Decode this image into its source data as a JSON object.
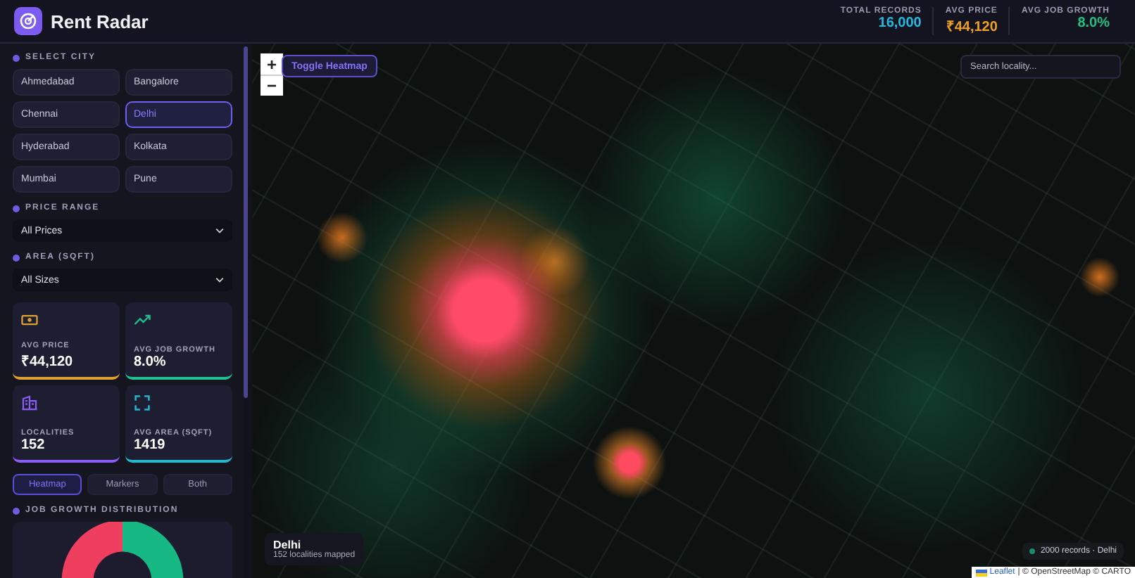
{
  "header": {
    "title": "Rent Radar",
    "stats": [
      {
        "label": "TOTAL RECORDS",
        "value": "16,000",
        "color": "#22b8e0"
      },
      {
        "label": "AVG PRICE",
        "value": "₹44,120",
        "color": "#f0a020"
      },
      {
        "label": "AVG JOB GROWTH",
        "value": "8.0%",
        "color": "#20c080"
      }
    ]
  },
  "sidebar": {
    "city_heading": "SELECT CITY",
    "cities": [
      {
        "label": "Ahmedabad",
        "selected": false
      },
      {
        "label": "Bangalore",
        "selected": false
      },
      {
        "label": "Chennai",
        "selected": false
      },
      {
        "label": "Delhi",
        "selected": true
      },
      {
        "label": "Hyderabad",
        "selected": false
      },
      {
        "label": "Kolkata",
        "selected": false
      },
      {
        "label": "Mumbai",
        "selected": false
      },
      {
        "label": "Pune",
        "selected": false
      }
    ],
    "price_heading": "PRICE RANGE",
    "price_value": "All Prices",
    "area_heading": "AREA (SQFT)",
    "area_value": "All Sizes",
    "cards": [
      {
        "kind": "price",
        "label": "AVG PRICE",
        "value": "₹44,120",
        "color": "#e0a030"
      },
      {
        "kind": "growth",
        "label": "AVG JOB GROWTH",
        "value": "8.0%",
        "color": "#20c090"
      },
      {
        "kind": "localities",
        "label": "LOCALITIES",
        "value": "152",
        "color": "#8b5cf6"
      },
      {
        "kind": "area",
        "label": "AVG AREA (SQFT)",
        "value": "1419",
        "color": "#22b8d0"
      }
    ],
    "modes": [
      {
        "label": "Heatmap",
        "selected": true
      },
      {
        "label": "Markers",
        "selected": false
      },
      {
        "label": "Both",
        "selected": false
      }
    ],
    "distribution_heading": "JOB GROWTH DISTRIBUTION"
  },
  "map": {
    "zoom_in": "+",
    "zoom_out": "−",
    "toggle": "Toggle Heatmap",
    "search": {
      "placeholder": "Search locality..."
    },
    "legend": {
      "city": "Delhi",
      "subtitle": "152 localities mapped"
    },
    "records": "2000 records · Delhi",
    "attribution": {
      "link": "Leaflet",
      "rest": "| © OpenStreetMap © CARTO"
    }
  }
}
